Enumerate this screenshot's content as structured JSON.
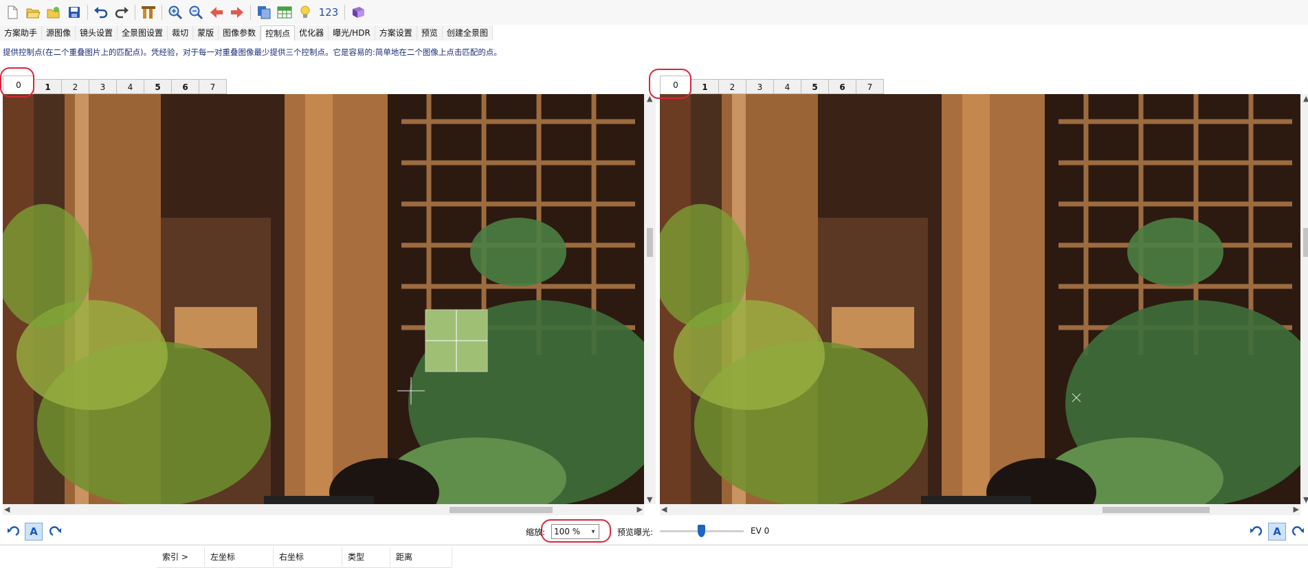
{
  "toolbar": {
    "icons": [
      "new-icon",
      "open-icon",
      "open-images-icon",
      "save-icon",
      "undo-icon",
      "redo-icon",
      "tools-icon",
      "zoom-in-icon",
      "zoom-out-icon",
      "previous-icon",
      "next-icon",
      "copy-icon",
      "table-icon",
      "lightbulb-icon",
      "numbers-icon",
      "help-book-icon"
    ],
    "number_label": "123"
  },
  "tabs": [
    "方案助手",
    "源图像",
    "镜头设置",
    "全景图设置",
    "裁切",
    "蒙版",
    "图像参数",
    "控制点",
    "优化器",
    "曝光/HDR",
    "方案设置",
    "预览",
    "创建全景图"
  ],
  "active_tab": "控制点",
  "hint": "提供控制点(在二个重叠图片上的匹配点)。凭经验，对于每一对重叠图像最少提供三个控制点。它是容易的:简单地在二个图像上点击匹配的点。",
  "left_panel": {
    "image_tabs": [
      "0",
      "1",
      "2",
      "3",
      "4",
      "5",
      "6",
      "7"
    ],
    "bold_tabs": [
      "1",
      "5",
      "6"
    ],
    "selected": "0"
  },
  "right_panel": {
    "image_tabs": [
      "0",
      "1",
      "2",
      "3",
      "4",
      "5",
      "6",
      "7"
    ],
    "bold_tabs": [
      "1",
      "5",
      "6"
    ],
    "selected": "0"
  },
  "controls": {
    "zoom_label": "缩放:",
    "zoom_value": "100 %",
    "exposure_label": "预览曝光:",
    "ev_value": "EV 0",
    "auto_label": "A"
  },
  "table": {
    "columns": [
      "索引 >",
      "左坐标",
      "右坐标",
      "类型",
      "距离"
    ]
  },
  "colors": {
    "annotation_red": "#d7263d",
    "accent_blue": "#1a67c4"
  }
}
